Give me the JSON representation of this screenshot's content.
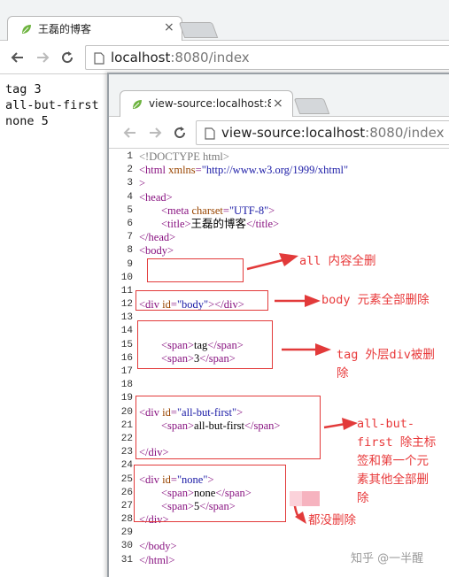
{
  "outer_browser": {
    "tab_title": "王磊的博客",
    "tab_close": "×",
    "url_host": "localhost",
    "url_rest": ":8080/index"
  },
  "rendered_page": {
    "lines": [
      "tag 3",
      "all-but-first",
      "none 5"
    ]
  },
  "inner_browser": {
    "tab_title": "view-source:localhost:8",
    "tab_close": "×",
    "url_host": "view-source:localhost",
    "url_rest": ":8080/index"
  },
  "source_lines": [
    {
      "num": "1"
    },
    {
      "num": "2"
    },
    {
      "num": "3"
    },
    {
      "num": "4"
    },
    {
      "num": "5"
    },
    {
      "num": "6"
    },
    {
      "num": "7"
    },
    {
      "num": "8"
    },
    {
      "num": "9"
    },
    {
      "num": "10"
    },
    {
      "num": "11"
    },
    {
      "num": "12"
    },
    {
      "num": "13"
    },
    {
      "num": "14"
    },
    {
      "num": "15"
    },
    {
      "num": "16"
    },
    {
      "num": "17"
    },
    {
      "num": "18"
    },
    {
      "num": "19"
    },
    {
      "num": "20"
    },
    {
      "num": "21"
    },
    {
      "num": "22"
    },
    {
      "num": "23"
    },
    {
      "num": "24"
    },
    {
      "num": "25"
    },
    {
      "num": "26"
    },
    {
      "num": "27"
    },
    {
      "num": "28"
    },
    {
      "num": "29"
    },
    {
      "num": "30"
    },
    {
      "num": "31"
    }
  ],
  "source": {
    "doctype": "<!DOCTYPE html>",
    "html_open": "<html",
    "xmlns_name": " xmlns",
    "xmlns_value": "\"http://www.w3.org/1999/xhtml\"",
    "gt": ">",
    "head_open": "<head>",
    "meta_open": "<meta",
    "charset_name": " charset",
    "charset_value": "\"UTF-8\"",
    "title_open": "<title>",
    "title_text": "王磊的博客",
    "title_close": "</title>",
    "head_close": "</head>",
    "body_open": "<body>",
    "div_open": "<div",
    "id_name": " id",
    "body_id_value": "\"body\"",
    "div_close": "</div>",
    "span_open": "<span>",
    "span_close": "</span>",
    "span_tag_text": "tag",
    "span_3_text": "3",
    "abf_id_value": "\"all-but-first\"",
    "span_abf_text": "all-but-first",
    "none_id_value": "\"none\"",
    "span_none_text": "none",
    "span_5_text": "5",
    "body_close": "</body>",
    "html_close": "</html>"
  },
  "annotations": {
    "all": "all 内容全删",
    "body": "body 元素全部删除",
    "tag_line1": "tag 外层div被删",
    "tag_line2": "除",
    "abf_line1": "all-but-",
    "abf_line2": "first 除主标",
    "abf_line3": "签和第一个元",
    "abf_line4": "素其他全部删",
    "abf_line5": "除",
    "none": "都没删除"
  },
  "watermark": "知乎 @一半醒",
  "colors": {
    "annotation_red": "#e8393a",
    "tag_purple": "#881280",
    "attr_name": "#994500",
    "attr_value": "#1a1aa6"
  }
}
